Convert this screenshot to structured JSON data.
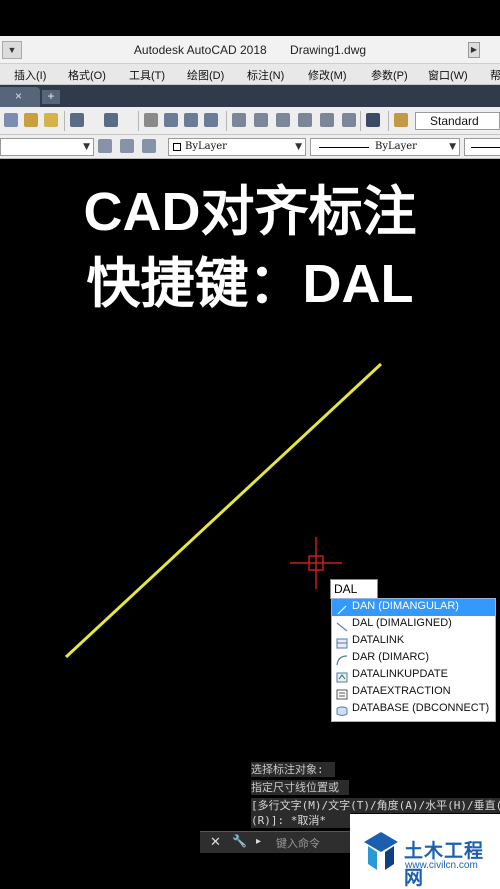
{
  "window": {
    "title": "Autodesk AutoCAD 2018",
    "document": "Drawing1.dwg"
  },
  "menu": [
    "插入(I)",
    "格式(O)",
    "工具(T)",
    "绘图(D)",
    "标注(N)",
    "修改(M)",
    "参数(P)",
    "窗口(W)",
    "帮"
  ],
  "tabs": {
    "close_glyph": "×",
    "add_glyph": "+"
  },
  "toolbar": {
    "text_style": "Standard"
  },
  "properties": {
    "layer": "ByLayer",
    "linetype": "ByLayer"
  },
  "overlay": {
    "line1": "CAD对齐标注",
    "line2": "快捷键：DAL"
  },
  "command_input": {
    "value": "DAL"
  },
  "autocomplete": [
    {
      "label": "DAN (DIMANGULAR)",
      "icon": "angular-dim-icon",
      "selected": true
    },
    {
      "label": "DAL (DIMALIGNED)",
      "icon": "aligned-dim-icon",
      "selected": false
    },
    {
      "label": "DATALINK",
      "icon": "datalink-icon",
      "selected": false
    },
    {
      "label": "DAR (DIMARC)",
      "icon": "arc-dim-icon",
      "selected": false
    },
    {
      "label": "DATALINKUPDATE",
      "icon": "datalink-update-icon",
      "selected": false
    },
    {
      "label": "DATAEXTRACTION",
      "icon": "data-extraction-icon",
      "selected": false
    },
    {
      "label": "DATABASE (DBCONNECT)",
      "icon": "database-icon",
      "selected": false
    }
  ],
  "history": [
    "选择标注对象:",
    "指定尺寸线位置或",
    "[多行文字(M)/文字(T)/角度(A)/水平(H)/垂直(V)/旋转",
    "(R)]: *取消*"
  ],
  "command_line": {
    "placeholder": "键入命令",
    "prompt_glyph": "▸"
  },
  "watermark": {
    "name": "土木工程网",
    "url": "www.civilcn.com"
  },
  "colors": {
    "drawn_line": "#e6e641",
    "crosshair": "#c81e1e",
    "selection": "#3399ff",
    "watermark": "#1c5fb0"
  }
}
